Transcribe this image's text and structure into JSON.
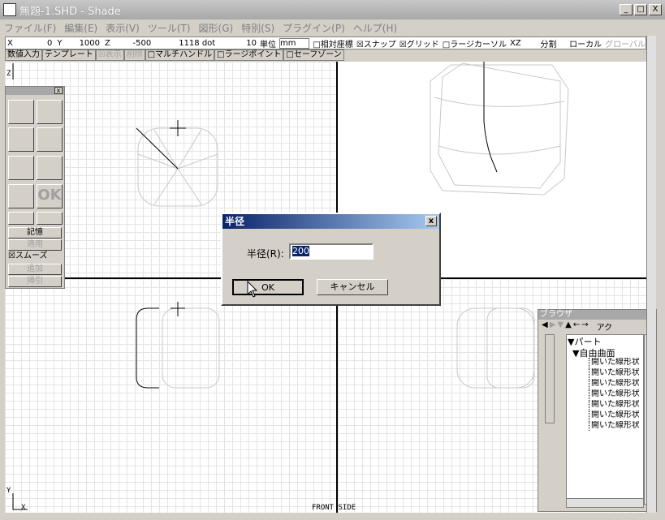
{
  "window": {
    "title": "無題-1.SHD - Shade",
    "min": "_",
    "max": "□",
    "close": "X"
  },
  "menu": [
    "ファイル(F)",
    "編集(E)",
    "表示(V)",
    "ツール(T)",
    "図形(G)",
    "特別(S)",
    "プラグイン(P)",
    "ヘルプ(H)"
  ],
  "coords": {
    "x_label": "X",
    "x": "0",
    "y_label": "Y",
    "y": "1000",
    "z_label": "Z",
    "z": "-500",
    "dot": "1118 dot",
    "grid": "10",
    "unit_label": "単位",
    "unit": "mm",
    "relative": "□相対座標",
    "snap": "☒スナップ",
    "gridopt": "☒グリッド",
    "cursor": "□ラージカーソル",
    "plane": "XZ",
    "split": "分割",
    "local": "ローカル",
    "global": "グローバル"
  },
  "options": [
    "数値入力",
    "テンプレート",
    "☒表示",
    "削除",
    "□マルチハンドル",
    "□ラージポイント",
    "□セーフゾーン"
  ],
  "palette": {
    "remember": "記憶",
    "apply": "適用",
    "smooth": "☒スムーズ",
    "add": "追加",
    "subtract": "掃引",
    "ok": "OK"
  },
  "dialog": {
    "title": "半径",
    "label": "半径(R):",
    "value": "200",
    "ok": "OK",
    "cancel": "キャンセル"
  },
  "browser": {
    "title": "ブラウザ",
    "tab": "アク",
    "part": "▼パート",
    "freeform": "▼自由曲面",
    "items": [
      "開いた線形状",
      "開いた線形状",
      "開いた線形状",
      "開いた線形状",
      "開いた線形状",
      "開いた線形状",
      "開いた線形状"
    ]
  },
  "viewport": {
    "label": "FRONT SIDE",
    "axis_y": "Y",
    "axis_x": "X",
    "axis_z": "Z"
  }
}
